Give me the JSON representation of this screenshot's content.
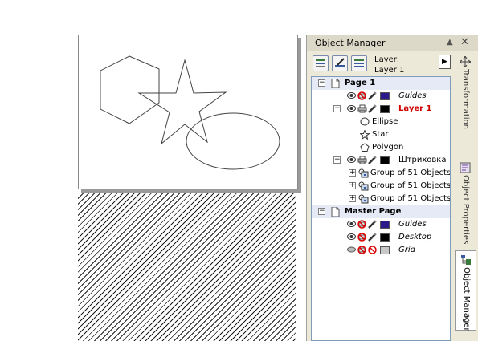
{
  "panel": {
    "title": "Object Manager",
    "layer_caption": "Layer:",
    "layer_name": "Layer 1"
  },
  "tree": [
    {
      "id": "page1",
      "label": "Page 1",
      "style": "bold",
      "level": 0,
      "expander": "minus",
      "icon": "page-icon",
      "highlight": true
    },
    {
      "id": "guides1",
      "label": "Guides",
      "style": "italic",
      "level": 1,
      "icons": [
        "eye-icon",
        "no-print-icon",
        "pencil-icon"
      ],
      "swatch": "#2a1a8c"
    },
    {
      "id": "layer1",
      "label": "Layer 1",
      "style": "red",
      "level": 1,
      "expander": "minus",
      "icons": [
        "eye-icon",
        "printer-icon",
        "pencil-icon"
      ],
      "swatch": "#000000"
    },
    {
      "id": "ellipse",
      "label": "Ellipse",
      "style": "normal",
      "level": 2,
      "icon": "ellipse-icon"
    },
    {
      "id": "star",
      "label": "Star",
      "style": "normal",
      "level": 2,
      "icon": "star-icon"
    },
    {
      "id": "polygon",
      "label": "Polygon",
      "style": "normal",
      "level": 2,
      "icon": "polygon-icon"
    },
    {
      "id": "hatching",
      "label": "Штриховка",
      "style": "normal",
      "level": 1,
      "expander": "minus",
      "icons": [
        "eye-icon",
        "printer-icon",
        "pencil-icon"
      ],
      "swatch": "#000000"
    },
    {
      "id": "g1",
      "label": "Group of 51 Objects",
      "style": "normal",
      "level": 2,
      "expander": "plus",
      "icon": "group-icon"
    },
    {
      "id": "g2",
      "label": "Group of 51 Objects",
      "style": "normal",
      "level": 2,
      "expander": "plus",
      "icon": "group-icon"
    },
    {
      "id": "g3",
      "label": "Group of 51 Objects",
      "style": "normal",
      "level": 2,
      "expander": "plus",
      "icon": "group-icon"
    },
    {
      "id": "master",
      "label": "Master Page",
      "style": "bold",
      "level": 0,
      "expander": "minus",
      "icon": "page-icon",
      "highlight": true
    },
    {
      "id": "guides2",
      "label": "Guides",
      "style": "italic",
      "level": 1,
      "icons": [
        "eye-icon",
        "no-print-icon",
        "pencil-icon"
      ],
      "swatch": "#2a1a8c"
    },
    {
      "id": "desktop",
      "label": "Desktop",
      "style": "italic",
      "level": 1,
      "icons": [
        "eye-icon",
        "no-print-icon",
        "pencil-icon"
      ],
      "swatch": "#000000"
    },
    {
      "id": "grid",
      "label": "Grid",
      "style": "italic",
      "level": 1,
      "icons": [
        "eye-closed-icon",
        "no-print-icon",
        "no-edit-icon"
      ],
      "swatch": "#c8c8c8"
    }
  ],
  "tabs": [
    {
      "label": "Transformation",
      "icon": "move-icon",
      "active": false
    },
    {
      "label": "Object Properties",
      "icon": "properties-icon",
      "active": false
    },
    {
      "label": "Object Manager",
      "icon": "tree-icon",
      "active": true
    }
  ]
}
